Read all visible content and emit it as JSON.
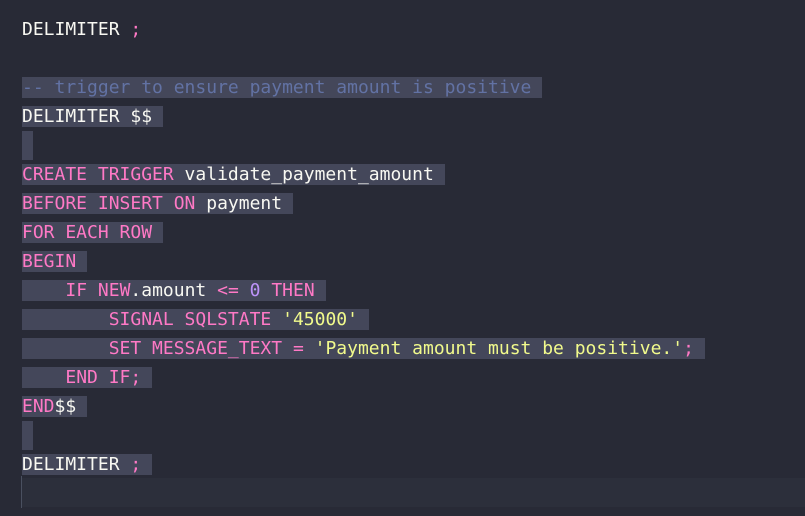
{
  "code": {
    "l1": {
      "a": "DELIMITER",
      "b": " ",
      "c": ";"
    },
    "l3": {
      "a": "-- trigger to ensure payment amount is positive",
      "pad": " "
    },
    "l4": {
      "a": "DELIMITER $$",
      "pad": " "
    },
    "l6": {
      "a": "CREATE TRIGGER",
      "b": " validate_payment_amount",
      "pad": " "
    },
    "l7": {
      "a": "BEFORE INSERT ON",
      "b": " payment",
      "pad": " "
    },
    "l8": {
      "a": "FOR EACH ROW",
      "pad": " "
    },
    "l9": {
      "a": "BEGIN",
      "pad": " "
    },
    "l10": {
      "indent": "    ",
      "a": "IF",
      "b": " ",
      "c": "NEW",
      "d": ".amount ",
      "e": "<=",
      "f": " ",
      "g": "0",
      "h": " ",
      "i": "THEN",
      "pad": " "
    },
    "l11": {
      "indent": "        ",
      "a": "SIGNAL SQLSTATE",
      "b": " ",
      "c": "'45000'",
      "pad": " "
    },
    "l12": {
      "indent": "        ",
      "a": "SET MESSAGE_TEXT",
      "b": " ",
      "c": "=",
      "d": " ",
      "e": "'Payment amount must be positive.'",
      "f": ";",
      "pad": " "
    },
    "l13": {
      "indent": "    ",
      "a": "END IF;",
      "pad": " "
    },
    "l14": {
      "a": "END",
      "b": "$$",
      "pad": " "
    },
    "l16": {
      "a": "DELIMITER",
      "b": " ",
      "c": ";",
      "pad": " "
    }
  },
  "colors": {
    "background": "#282a36",
    "selection": "#44475a",
    "keyword": "#ff79c6",
    "comment": "#6272a4",
    "string": "#f1fa8c",
    "number": "#bd93f9",
    "text": "#f8f8f2"
  }
}
